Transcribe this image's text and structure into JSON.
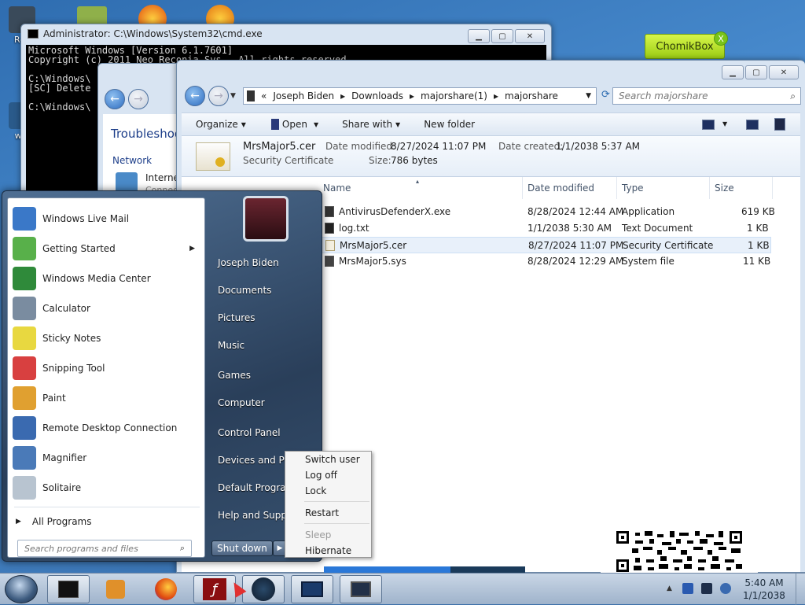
{
  "desktop": {
    "icons": [
      {
        "label": "Rec"
      },
      {
        "label": "wel"
      }
    ],
    "chomikbox": {
      "label": "ChomikBox",
      "close": "X"
    }
  },
  "cmd": {
    "title": "Administrator: C:\\Windows\\System32\\cmd.exe",
    "lines": [
      "Microsoft Windows [Version 6.1.7601]",
      "Copyright (c) 2011 Neo Reconia Sys.  All rights reserved.",
      "",
      "C:\\Windows\\",
      "[SC] Delete",
      "",
      "C:\\Windows\\"
    ]
  },
  "control_panel": {
    "title": "Troubleshoo",
    "category": "Network",
    "item": "Internet",
    "item_sub": "Connec"
  },
  "explorer": {
    "breadcrumb": [
      "Joseph Biden",
      "Downloads",
      "majorshare(1)",
      "majorshare"
    ],
    "crumb_prefix": "«",
    "search_placeholder": "Search majorshare",
    "toolbar": {
      "organize": "Organize",
      "open": "Open",
      "share": "Share with",
      "new_folder": "New folder"
    },
    "details": {
      "name": "MrsMajor5.cer",
      "type": "Security Certificate",
      "modified_label": "Date modified:",
      "modified": "8/27/2024 11:07 PM",
      "created_label": "Date created:",
      "created": "1/1/2038 5:37 AM",
      "size_label": "Size:",
      "size": "786 bytes"
    },
    "columns": {
      "name": "Name",
      "date": "Date modified",
      "type": "Type",
      "size": "Size"
    },
    "files": [
      {
        "name": "AntivirusDefenderX.exe",
        "date": "8/28/2024 12:44 AM",
        "type": "Application",
        "size": "619 KB"
      },
      {
        "name": "log.txt",
        "date": "1/1/2038 5:30 AM",
        "type": "Text Document",
        "size": "1 KB"
      },
      {
        "name": "MrsMajor5.cer",
        "date": "8/27/2024 11:07 PM",
        "type": "Security Certificate",
        "size": "1 KB"
      },
      {
        "name": "MrsMajor5.sys",
        "date": "8/28/2024 12:29 AM",
        "type": "System file",
        "size": "11 KB"
      }
    ]
  },
  "start_menu": {
    "programs": [
      {
        "label": "Windows Live Mail",
        "color": "#3a78c8"
      },
      {
        "label": "Getting Started",
        "color": "#58b04a"
      },
      {
        "label": "Windows Media Center",
        "color": "#2f8a3a"
      },
      {
        "label": "Calculator",
        "color": "#7a8ca0"
      },
      {
        "label": "Sticky Notes",
        "color": "#e8d840"
      },
      {
        "label": "Snipping Tool",
        "color": "#d84040"
      },
      {
        "label": "Paint",
        "color": "#e0a030"
      },
      {
        "label": "Remote Desktop Connection",
        "color": "#3a6ab0"
      },
      {
        "label": "Magnifier",
        "color": "#4a7ab8"
      },
      {
        "label": "Solitaire",
        "color": "#b8c4d0"
      }
    ],
    "submenu_arrow": "▶",
    "all_programs": "All Programs",
    "search_placeholder": "Search programs and files",
    "right_items": [
      "Joseph Biden",
      "Documents",
      "Pictures",
      "Music",
      "Games",
      "Computer",
      "Control Panel",
      "Devices and Printers",
      "Default Programs",
      "Help and Support"
    ],
    "shutdown": "Shut down"
  },
  "context_menu": {
    "items": [
      {
        "label": "Switch user",
        "enabled": true
      },
      {
        "label": "Log off",
        "enabled": true
      },
      {
        "label": "Lock",
        "enabled": true
      },
      {
        "label": "Restart",
        "enabled": true
      },
      {
        "label": "Sleep",
        "enabled": false
      },
      {
        "label": "Hibernate",
        "enabled": true
      }
    ]
  },
  "progress": {
    "value": 0.63
  },
  "taskbar": {
    "time": "5:40 AM",
    "date": "1/1/2038"
  }
}
